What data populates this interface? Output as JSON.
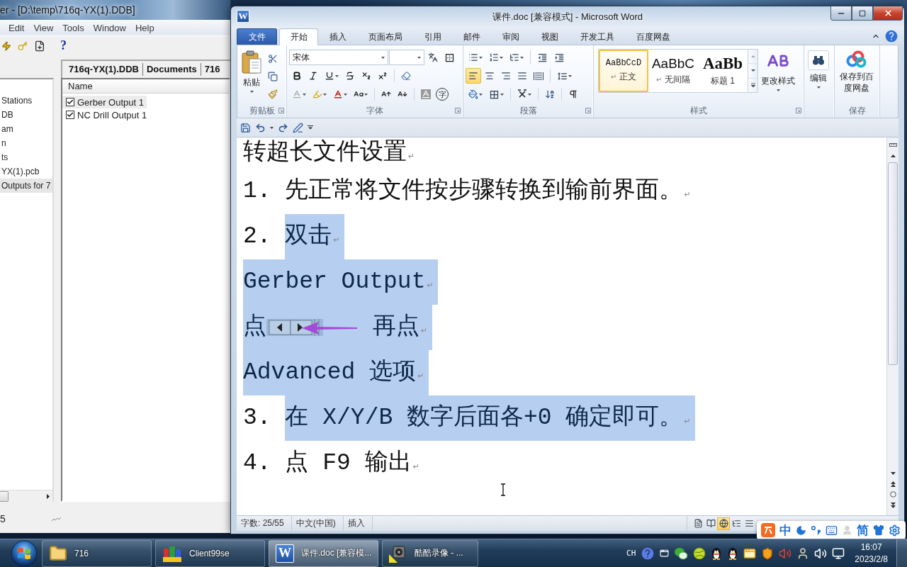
{
  "protel_window": {
    "title": "er - [D:\\temp\\716q-YX(1).DDB]",
    "menu": [
      "Edit",
      "View",
      "Tools",
      "Window",
      "Help"
    ],
    "help_glyph": "?",
    "tree": [
      {
        "label": "Stations",
        "selected": false
      },
      {
        "label": "DB",
        "selected": false
      },
      {
        "label": "am",
        "selected": false
      },
      {
        "label": "n",
        "selected": false
      },
      {
        "label": "ts",
        "selected": false
      },
      {
        "label": "YX(1).pcb",
        "selected": false
      },
      {
        "label": "Outputs for 7",
        "selected": true
      }
    ],
    "tabs": [
      "716q-YX(1).DDB",
      "Documents",
      "716"
    ],
    "list": {
      "header": "Name",
      "items": [
        {
          "label": "Gerber Output 1",
          "checked": true,
          "selected": true
        },
        {
          "label": "NC Drill Output 1",
          "checked": true,
          "selected": false
        }
      ]
    },
    "status": "5"
  },
  "word_window": {
    "logo_letter": "W",
    "title": "课件.doc [兼容模式] - Microsoft Word",
    "tabs": [
      {
        "label": "文件",
        "kind": "file",
        "selected": false
      },
      {
        "label": "开始",
        "kind": "tab",
        "selected": true
      },
      {
        "label": "插入",
        "kind": "tab",
        "selected": false
      },
      {
        "label": "页面布局",
        "kind": "tab",
        "selected": false
      },
      {
        "label": "引用",
        "kind": "tab",
        "selected": false
      },
      {
        "label": "邮件",
        "kind": "tab",
        "selected": false
      },
      {
        "label": "审阅",
        "kind": "tab",
        "selected": false
      },
      {
        "label": "视图",
        "kind": "tab",
        "selected": false
      },
      {
        "label": "开发工具",
        "kind": "tab",
        "selected": false
      },
      {
        "label": "百度网盘",
        "kind": "tab",
        "selected": false
      }
    ],
    "ribbon": {
      "groups": [
        {
          "kind": "clipboard",
          "label": "剪贴板",
          "paste_label": "粘贴"
        },
        {
          "kind": "font",
          "label": "字体",
          "font_name": "宋体",
          "enclose_glyph": "字"
        },
        {
          "kind": "paragraph",
          "label": "段落",
          "alignments": [
            {
              "kind": "left",
              "selected": true
            },
            {
              "kind": "center",
              "selected": false
            },
            {
              "kind": "right",
              "selected": false
            },
            {
              "kind": "justify",
              "selected": false
            },
            {
              "kind": "distributed",
              "selected": false
            }
          ]
        },
        {
          "kind": "styles",
          "label": "样式",
          "styles": [
            {
              "kind": "body",
              "preview": "AaBbCcD",
              "mark": "↵",
              "name": "正文",
              "selected": true
            },
            {
              "kind": "no_spacing",
              "preview": "AaBbC",
              "mark": "↵",
              "name": "无间隔",
              "selected": false
            },
            {
              "kind": "heading",
              "preview": "AaBb",
              "name": "标题 1",
              "selected": false
            }
          ],
          "change_label": "更改样式"
        },
        {
          "kind": "editing",
          "button_label": "编辑"
        },
        {
          "kind": "save",
          "button_label": "保存到百度网盘",
          "label": "保存"
        }
      ]
    },
    "document": {
      "paragraphs": [
        {
          "mark": "↵",
          "runs": [
            {
              "kind": "text",
              "text": "转超长文件设置",
              "selected": false
            }
          ]
        },
        {
          "mark": "↵",
          "runs": [
            {
              "kind": "text",
              "text": "1. 先正常将文件按步骤转换到输前界面。",
              "selected": false
            }
          ]
        },
        {
          "mark": "↵",
          "runs": [
            {
              "kind": "text",
              "text": "2. ",
              "selected": false
            },
            {
              "kind": "text",
              "text": "双击",
              "selected": true
            }
          ]
        },
        {
          "mark": "↵",
          "runs": [
            {
              "kind": "text",
              "text": "Gerber Output",
              "selected": true
            }
          ]
        },
        {
          "mark": "↵",
          "runs": [
            {
              "kind": "text",
              "text": "点",
              "selected": true
            },
            {
              "kind": "picture",
              "selected": true
            },
            {
              "kind": "text",
              "text": "再点",
              "selected": true
            }
          ]
        },
        {
          "mark": "↵",
          "runs": [
            {
              "kind": "text",
              "text": "Advanced 选项",
              "selected": true
            }
          ]
        },
        {
          "mark": "↵",
          "runs": [
            {
              "kind": "text",
              "text": "3. ",
              "selected": false
            },
            {
              "kind": "text",
              "text": "在 X/Y/B 数字后面各+0 确定即可。",
              "selected": true
            }
          ]
        },
        {
          "mark": "↵",
          "runs": [
            {
              "kind": "text",
              "text": "4. 点 F9 输出",
              "selected": false
            }
          ]
        }
      ]
    },
    "status_bar": {
      "word_count": "字数: 25/55",
      "language": "中文(中国)",
      "mode": "插入",
      "views": [
        {
          "kind": "print",
          "selected": false
        },
        {
          "kind": "reading",
          "selected": false
        },
        {
          "kind": "web",
          "selected": true
        },
        {
          "kind": "outline",
          "selected": false
        },
        {
          "kind": "draft",
          "selected": false
        }
      ]
    }
  },
  "ime_bar": {
    "mode": "中",
    "script": "简"
  },
  "taskbar": {
    "buttons": [
      {
        "label": "716",
        "kind": "folder",
        "selected": false
      },
      {
        "label": "Client99se",
        "kind": "client",
        "selected": false
      },
      {
        "label": "课件.doc [兼容模...",
        "kind": "word",
        "icon_letter": "W",
        "selected": true
      },
      {
        "label": "酷酷录像 - ...",
        "kind": "recorder",
        "selected": false
      }
    ],
    "language": "CH",
    "time": "16:07",
    "date": "2023/2/8"
  }
}
